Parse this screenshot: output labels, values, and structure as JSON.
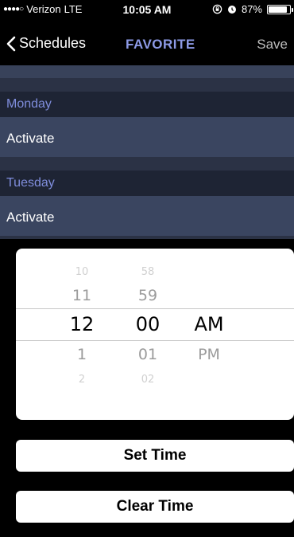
{
  "status_bar": {
    "signal": "●●●●○",
    "carrier": "Verizon",
    "network": "LTE",
    "time": "10:05 AM",
    "battery_percent": "87%",
    "battery_level": 0.87,
    "icons": [
      "lock-rotation-icon",
      "alarm-icon",
      "battery-icon"
    ]
  },
  "nav": {
    "back_label": "Schedules",
    "title": "FAVORITE",
    "save_label": "Save"
  },
  "schedule": [
    {
      "day": "Monday",
      "action": "Activate"
    },
    {
      "day": "Tuesday",
      "action": "Activate"
    }
  ],
  "picker": {
    "hours": [
      "10",
      "11",
      "12",
      "1",
      "2"
    ],
    "minutes": [
      "58",
      "59",
      "00",
      "01",
      "02"
    ],
    "period": [
      "AM",
      "PM"
    ],
    "selected": {
      "hour": "12",
      "minute": "00",
      "period": "AM"
    }
  },
  "buttons": {
    "set_time": "Set Time",
    "clear_time": "Clear Time"
  },
  "colors": {
    "accent": "#8d9ae6",
    "list_bg": "#3a4560",
    "header_bg": "#1e2434"
  }
}
